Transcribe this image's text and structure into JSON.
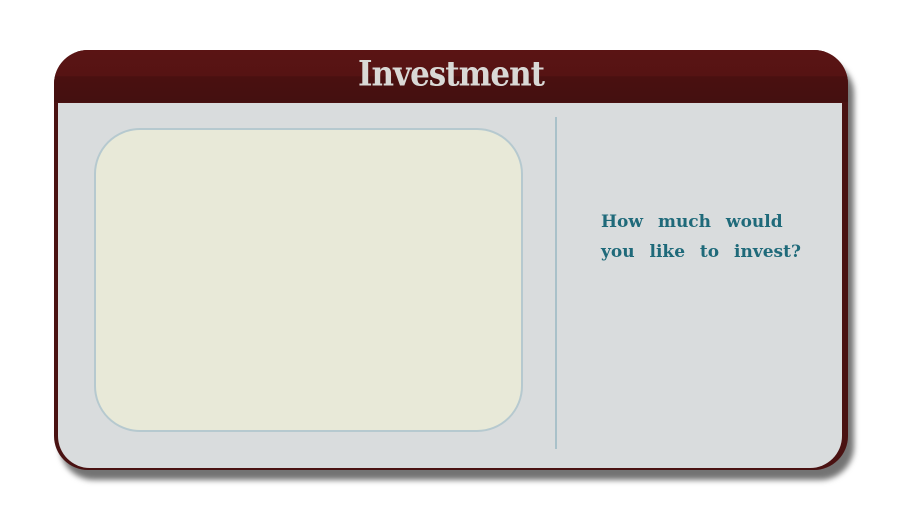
{
  "dialog": {
    "title": "Investment",
    "prompt_line1": "How much would",
    "prompt_line2": "you like to invest?"
  },
  "colors": {
    "frame": "#4a1212",
    "header": "#5a1414",
    "body": "#d9dcdd",
    "panel": "#e8e9d8",
    "panel_border": "#b6c9cf",
    "prompt_text": "#1f6a7a",
    "title_text": "#d9d9d6"
  }
}
